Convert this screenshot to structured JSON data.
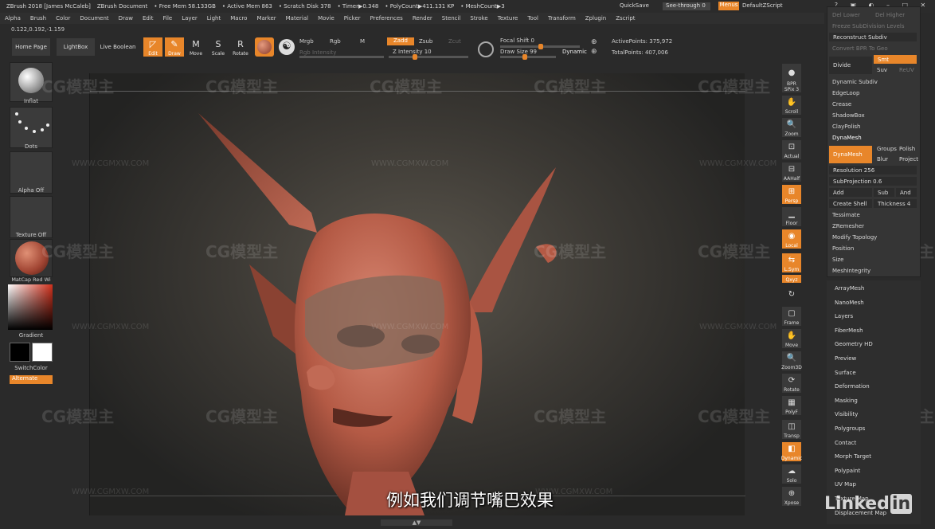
{
  "title": {
    "app": "ZBrush 2018 [James McCaleb]",
    "document": "ZBrush Document",
    "free_mem": "• Free Mem 58.133GB",
    "active_mem": "• Active Mem 863",
    "scratch": "• Scratch Disk 378",
    "timer": "• Timer▶0.348",
    "polycount": "• PolyCount▶411.131 KP",
    "meshcount": "• MeshCount▶3",
    "quicksave": "QuickSave",
    "seethrough": "See-through",
    "seethrough_val": "0",
    "menus": "Menus",
    "zscript": "DefaultZScript"
  },
  "menu": [
    "Alpha",
    "Brush",
    "Color",
    "Document",
    "Draw",
    "Edit",
    "File",
    "Layer",
    "Light",
    "Macro",
    "Marker",
    "Material",
    "Movie",
    "Picker",
    "Preferences",
    "Render",
    "Stencil",
    "Stroke",
    "Texture",
    "Tool",
    "Transform",
    "Zplugin",
    "Zscript"
  ],
  "coords": "0.122,0.192,-1.159",
  "toolbar": {
    "home": "Home Page",
    "lightbox": "LightBox",
    "live_boolean": "Live Boolean",
    "edit": "Edit",
    "draw": "Draw",
    "move": "Move",
    "scale": "Scale",
    "rotate": "Rotate",
    "mrgb": "Mrgb",
    "rgb": "Rgb",
    "m": "M",
    "zadd": "Zadd",
    "zsub": "Zsub",
    "zcut": "Zcut",
    "rgb_intensity": "Rgb Intensity",
    "z_intensity": "Z Intensity 10",
    "focal_shift": "Focal Shift 0",
    "draw_size": "Draw Size 99",
    "dynamic": "Dynamic",
    "active_points": "ActivePoints: 375,972",
    "total_points": "TotalPoints: 407,006"
  },
  "left_shelf": {
    "brush": "Inflat",
    "stroke": "Dots",
    "alpha": "Alpha Off",
    "texture": "Texture Off",
    "material": "MatCap Red Wi",
    "gradient": "Gradient",
    "switchcolor": "SwitchColor",
    "alternate": "Alternate"
  },
  "right_dock": {
    "bpr": "BPR",
    "spix": "SPix 3",
    "scroll": "Scroll",
    "zoom": "Zoom",
    "actual": "Actual",
    "aahalf": "AAHalf",
    "persp": "Persp",
    "floor": "Floor",
    "local": "Local",
    "lsym": "L.Sym",
    "xyz": "Qxyz",
    "frame": "Frame",
    "move": "Move",
    "zoom3d": "Zoom3D",
    "rotate": "Rotate",
    "polyf": "PolyF",
    "transp": "Transp",
    "ghost": "Dynamic",
    "solo": "Solo",
    "xpose": "Xpose"
  },
  "right_panel": {
    "top1": "Del Lower",
    "top2": "Del Higher",
    "freeze": "Freeze SubDivision Levels",
    "reconstruct": "Reconstruct Subdiv",
    "convert": "Convert BPR To Geo",
    "divide": "Divide",
    "smt": "Smt",
    "suv": "Suv",
    "reuv": "ReUV",
    "dynamic_subdiv": "Dynamic Subdiv",
    "edgeloop": "EdgeLoop",
    "crease": "Crease",
    "shadowbox": "ShadowBox",
    "claypolish": "ClayPolish",
    "dynamesh_header": "DynaMesh",
    "dynamesh_btn": "DynaMesh",
    "groups": "Groups",
    "polish": "Polish",
    "blur": "Blur",
    "project": "Project",
    "resolution": "Resolution 256",
    "subprojection": "SubProjection 0.6",
    "add": "Add",
    "sub": "Sub",
    "and": "And",
    "create_shell": "Create Shell",
    "thickness": "Thickness 4",
    "tessimate": "Tessimate",
    "zremesher": "ZRemesher",
    "modify_topology": "Modify Topology",
    "position": "Position",
    "size": "Size",
    "meshintegrity": "MeshIntegrity"
  },
  "right_list": [
    "ArrayMesh",
    "NanoMesh",
    "Layers",
    "FiberMesh",
    "Geometry HD",
    "Preview",
    "Surface",
    "Deformation",
    "Masking",
    "Visibility",
    "Polygroups",
    "Contact",
    "Morph Target",
    "Polypaint",
    "UV Map",
    "Texture Map",
    "Displacement Map"
  ],
  "watermark": "CG模型主",
  "watermark_url": "WWW.CGMXW.COM",
  "subtitle": "例如我们调节嘴巴效果",
  "linkedin": {
    "text": "Linked",
    "in": "in"
  },
  "colors": {
    "accent": "#e8862a",
    "panel": "#353535",
    "model": "#b85a45"
  }
}
